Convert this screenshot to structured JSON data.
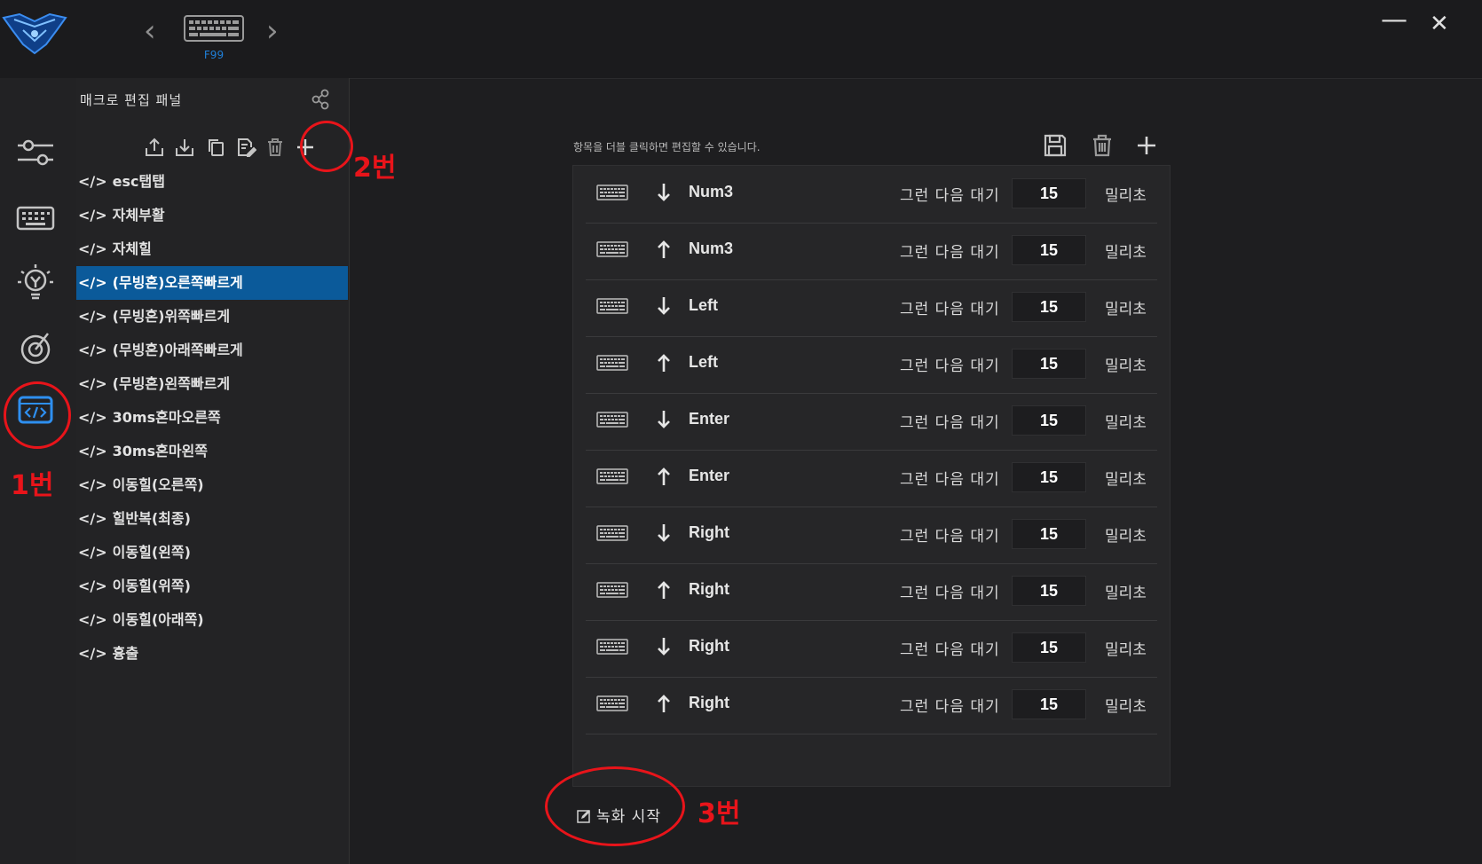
{
  "header": {
    "prev_icon": "chevron-left-icon",
    "next_icon": "chevron-right-icon",
    "device_icon": "keyboard-icon",
    "device_name": "F99",
    "minimize_glyph": "—",
    "close_glyph": "✕"
  },
  "sidebar": {
    "items": [
      {
        "name": "performance",
        "icon": "sliders-icon"
      },
      {
        "name": "keys",
        "icon": "keyboard-icon"
      },
      {
        "name": "lighting",
        "icon": "bulb-icon"
      },
      {
        "name": "profile",
        "icon": "target-icon"
      },
      {
        "name": "macro",
        "icon": "code-icon",
        "active": true
      }
    ]
  },
  "macro_panel": {
    "title": "매크로 편집 패널",
    "toolbar_icons": [
      "export-icon",
      "import-icon",
      "copy-icon",
      "rename-icon",
      "delete-icon",
      "add-icon"
    ],
    "tag": "</>",
    "selected_index": 3,
    "items": [
      "esc탭탭",
      "자체부활",
      "자체힐",
      "(무빙혼)오른쪽빠르게",
      "(무빙혼)위쪽빠르게",
      "(무빙혼)아래쪽빠르게",
      "(무빙혼)왼쪽빠르게",
      "30ms혼마오른쪽",
      "30ms혼마왼쪽",
      "이동힐(오른쪽)",
      "힐반복(최종)",
      "이동힐(왼쪽)",
      "이동힐(위쪽)",
      "이동힐(아래쪽)",
      "흉출"
    ]
  },
  "editor": {
    "hint": "항목을 더블 클릭하면 편집할 수 있습니다.",
    "icons": [
      "save-icon",
      "delete-icon",
      "add-icon"
    ],
    "wait_label": "그런 다음 대기",
    "unit_label": "밀리초",
    "steps": [
      {
        "key": "Num3",
        "dir": "down",
        "delay": "15"
      },
      {
        "key": "Num3",
        "dir": "up",
        "delay": "15"
      },
      {
        "key": "Left",
        "dir": "down",
        "delay": "15"
      },
      {
        "key": "Left",
        "dir": "up",
        "delay": "15"
      },
      {
        "key": "Enter",
        "dir": "down",
        "delay": "15"
      },
      {
        "key": "Enter",
        "dir": "up",
        "delay": "15"
      },
      {
        "key": "Right",
        "dir": "down",
        "delay": "15"
      },
      {
        "key": "Right",
        "dir": "up",
        "delay": "15"
      },
      {
        "key": "Right",
        "dir": "down",
        "delay": "15"
      },
      {
        "key": "Right",
        "dir": "up",
        "delay": "15"
      }
    ],
    "record_label": "녹화 시작"
  },
  "annotations": {
    "label_1": "1번",
    "label_2": "2번",
    "label_3": "3번",
    "color": "#e8141a"
  },
  "colors": {
    "accent": "#1f7fd8",
    "selected_bg": "#0b5a9a"
  }
}
